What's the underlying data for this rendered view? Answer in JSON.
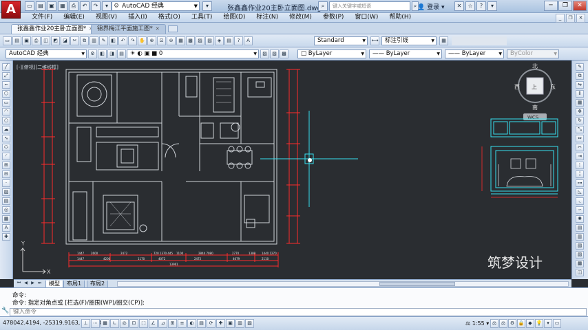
{
  "app": {
    "logo_letter": "A",
    "workspace": "AutoCAD 经典",
    "document_title": "张鑫鑫作业20主卧立面图.dwg",
    "search_placeholder": "键入关键字或短语",
    "login_label": "登录"
  },
  "menus": [
    "文件(F)",
    "编辑(E)",
    "视图(V)",
    "插入(I)",
    "格式(O)",
    "工具(T)",
    "绘图(D)",
    "标注(N)",
    "修改(M)",
    "参数(P)",
    "窗口(W)",
    "帮助(H)"
  ],
  "file_tabs": [
    {
      "label": "张鑫鑫作业20主卧立面图*",
      "active": true
    },
    {
      "label": "锦界梅江平面施工图*",
      "active": false
    }
  ],
  "toolbar": {
    "text_style": "Standard",
    "dim_style": "标注引线",
    "workspace_combo": "AutoCAD 经典",
    "layer": "0",
    "color": "ByLayer",
    "linetype": "ByLayer",
    "lineweight": "ByLayer",
    "plotstyle": "ByColor"
  },
  "viewport": {
    "label": "[-][俯视][二维线框]",
    "compass": {
      "north": "北",
      "south": "南",
      "east": "东",
      "west": "西",
      "center": "上",
      "wcs": "WCS"
    },
    "ucs_y": "Y",
    "ucs_x": "X",
    "watermark": "筑梦设计"
  },
  "dims": {
    "bottom_row1": [
      "1447",
      "2600",
      "2472",
      "720 1370 445",
      "1100",
      "2844 7080",
      "2770",
      "1380",
      "1440 1270"
    ],
    "bottom_row2": [
      "1447",
      "4200",
      "1170",
      "4072",
      "2472",
      "4079",
      "2110"
    ],
    "bottom_total": "13961"
  },
  "layout_tabs": [
    "模型",
    "布局1",
    "布局2"
  ],
  "command": {
    "line1": "命令:",
    "line2": "命令: 指定对角点或 [栏选(F)/圈围(WP)/圈交(CP)]:",
    "input_placeholder": "键入命令"
  },
  "status": {
    "coords": "478042.4194, -25319.9163, 0.0000",
    "scale": "1:55"
  },
  "colors": {
    "cyan": "#35e0ef",
    "red": "#ff2a2a",
    "white_line": "#cfd3d8",
    "bg": "#2a2d31"
  }
}
